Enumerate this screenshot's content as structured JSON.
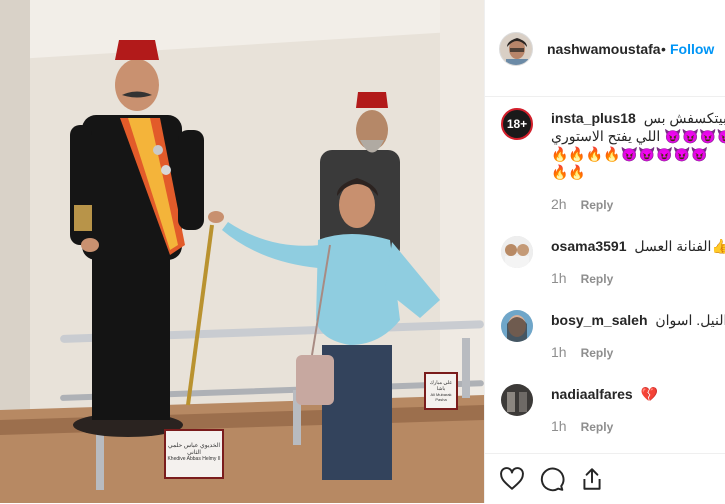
{
  "post": {
    "username": "nashwamoustafa",
    "separator": "•",
    "follow_label": "Follow"
  },
  "photo": {
    "placard_left_text": "الخديوي عباس حلمي الثاني",
    "placard_left_sub": "Khedive Abbas Helmy II",
    "placard_right_text": "علي مبارك باشا",
    "placard_right_sub": "Ali Mubarak Pasha"
  },
  "comments": [
    {
      "username": "insta_plus18",
      "avatar_label": "18+",
      "lines": [
        "مبيتكسفش بس _",
        "اللي يفتح الاستوري 😈😈😈😈",
        "🔥🔥🔥🔥😈😈😈😈😈",
        "🔥🔥"
      ],
      "time": "2h",
      "reply_label": "Reply"
    },
    {
      "username": "osama3591",
      "text": "الفنانة العسل👍",
      "time": "1h",
      "reply_label": "Reply"
    },
    {
      "username": "bosy_m_saleh",
      "text": "ف النيل. اسوان",
      "time": "1h",
      "reply_label": "Reply"
    },
    {
      "username": "nadiaalfares",
      "text": "💔",
      "time": "1h",
      "reply_label": "Reply"
    }
  ],
  "icons": {
    "like": "heart-icon",
    "comment": "comment-icon",
    "share": "share-icon"
  },
  "colors": {
    "follow_blue": "#0095f6",
    "username_text": "#262626",
    "meta_gray": "#8e8e8e",
    "badge_red": "#d21f2b"
  }
}
